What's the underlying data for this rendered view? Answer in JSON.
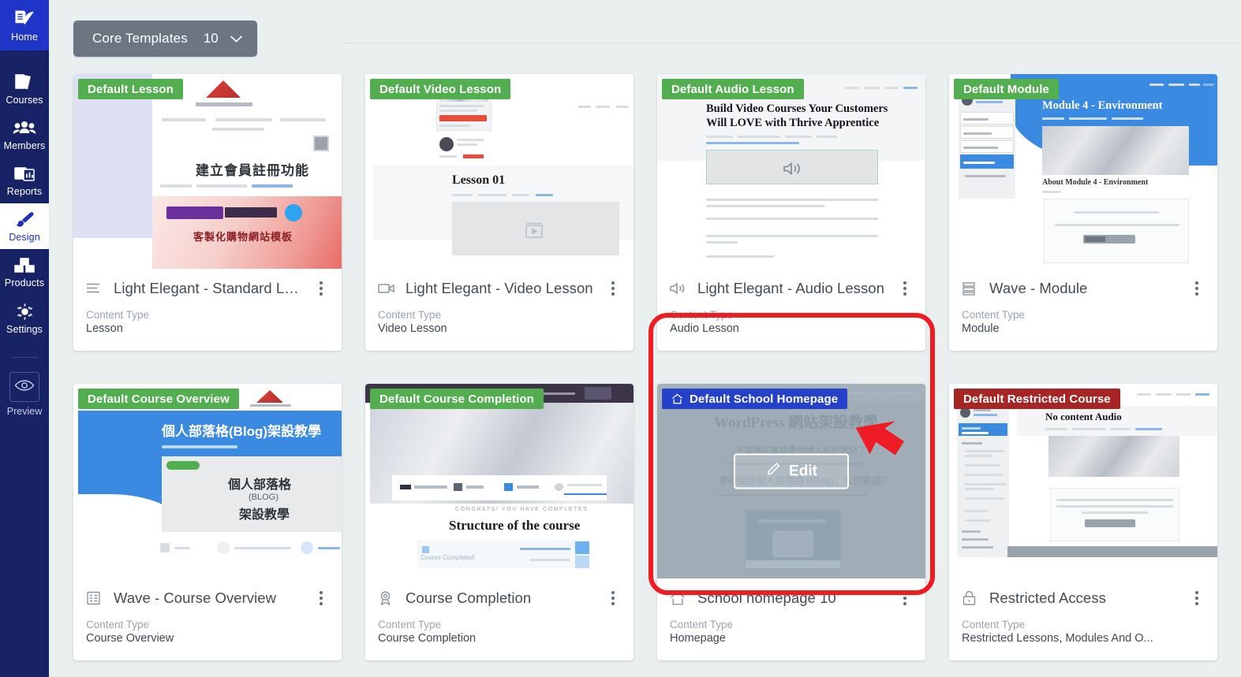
{
  "sidebar": {
    "items": [
      {
        "id": "home",
        "label": "Home",
        "icon": "book-leaf-icon",
        "active": false,
        "highlight": true
      },
      {
        "id": "courses",
        "label": "Courses",
        "icon": "books-icon",
        "active": false
      },
      {
        "id": "members",
        "label": "Members",
        "icon": "people-icon",
        "active": false
      },
      {
        "id": "reports",
        "label": "Reports",
        "icon": "reports-chart-icon",
        "active": false
      },
      {
        "id": "design",
        "label": "Design",
        "icon": "paintbrush-icon",
        "active": true
      },
      {
        "id": "products",
        "label": "Products",
        "icon": "boxes-icon",
        "active": false
      },
      {
        "id": "settings",
        "label": "Settings",
        "icon": "gear-icon",
        "active": false
      }
    ],
    "preview": {
      "label": "Preview",
      "icon": "eye-icon"
    }
  },
  "toolbar": {
    "filter_label": "Core Templates",
    "filter_count": "10",
    "chevron_icon": "chevron-down-icon"
  },
  "labels": {
    "content_type": "Content Type",
    "edit_button": "Edit",
    "edit_icon": "pencil-icon",
    "kebab_icon": "more-vertical-icon"
  },
  "colors": {
    "badge_green": "#52ae4f",
    "badge_blue": "#2540c9",
    "badge_red": "#a62626",
    "sidebar": "#182366",
    "home_tile": "#1f35c8",
    "accent_blue": "#2030b8",
    "highlight_ring": "#ef1c22",
    "chip_gray": "#6b7682",
    "page_bg": "#eaeff0"
  },
  "cards": [
    {
      "badge": "Default Lesson",
      "badge_color": "green",
      "badge_icon": null,
      "title": "Light Elegant - Standard Lesson",
      "title_icon": "lines-lesson-icon",
      "content_type": "Lesson",
      "thumb": "lesson",
      "highlighted": false
    },
    {
      "badge": "Default Video Lesson",
      "badge_color": "green",
      "badge_icon": null,
      "title": "Light Elegant - Video Lesson",
      "title_icon": "video-camera-icon",
      "content_type": "Video Lesson",
      "thumb": "video",
      "thumb_heading": "Lesson 01",
      "highlighted": false
    },
    {
      "badge": "Default Audio Lesson",
      "badge_color": "green",
      "badge_icon": null,
      "title": "Light Elegant - Audio Lesson",
      "title_icon": "speaker-icon",
      "content_type": "Audio Lesson",
      "thumb": "audio",
      "thumb_heading_1": "Build Video Courses Your Customers",
      "thumb_heading_2": "Will LOVE with Thrive Apprentice",
      "highlighted": false
    },
    {
      "badge": "Default Module",
      "badge_color": "green",
      "badge_icon": null,
      "title": "Wave - Module",
      "title_icon": "stacked-rows-icon",
      "content_type": "Module",
      "thumb": "module",
      "thumb_heading": "Module 4 - Environment",
      "thumb_sub": "About Module 4 - Environment",
      "highlighted": false
    },
    {
      "badge": "Default Course Overview",
      "badge_color": "green",
      "badge_icon": null,
      "title": "Wave - Course Overview",
      "title_icon": "list-card-icon",
      "content_type": "Course Overview",
      "thumb": "overview",
      "thumb_heading": "個人部落格(Blog)架設教學",
      "thumb_word_1": "個人部落格",
      "thumb_word_2": "(BLOG)",
      "thumb_word_3": "架設教學",
      "highlighted": false
    },
    {
      "badge": "Default Course Completion",
      "badge_color": "green",
      "badge_icon": null,
      "title": "Course Completion",
      "title_icon": "medal-icon",
      "content_type": "Course Completion",
      "thumb": "completion",
      "thumb_kicker": "CONGRATS! YOU HAVE COMPLETED",
      "thumb_heading": "Structure of the course",
      "thumb_note": "Course Completed!",
      "highlighted": false
    },
    {
      "badge": "Default School Homepage",
      "badge_color": "blue",
      "badge_icon": "home-icon",
      "title": "School homepage 10",
      "title_icon": "home-icon",
      "content_type": "Homepage",
      "thumb": "homepage",
      "thumb_heading": "WordPress 網站架設教學",
      "thumb_sub": "不要再花高額費用請人設計網站了！",
      "thumb_sub2": "學校架設個人部落格 (Blog)，公何要錢？",
      "highlighted": true
    },
    {
      "badge": "Default Restricted Course",
      "badge_color": "red",
      "badge_icon": null,
      "title": "Restricted Access",
      "title_icon": "lock-icon",
      "content_type": "Restricted Lessons, Modules And O...",
      "thumb": "restricted",
      "thumb_heading": "No content Audio",
      "highlighted": false
    }
  ]
}
